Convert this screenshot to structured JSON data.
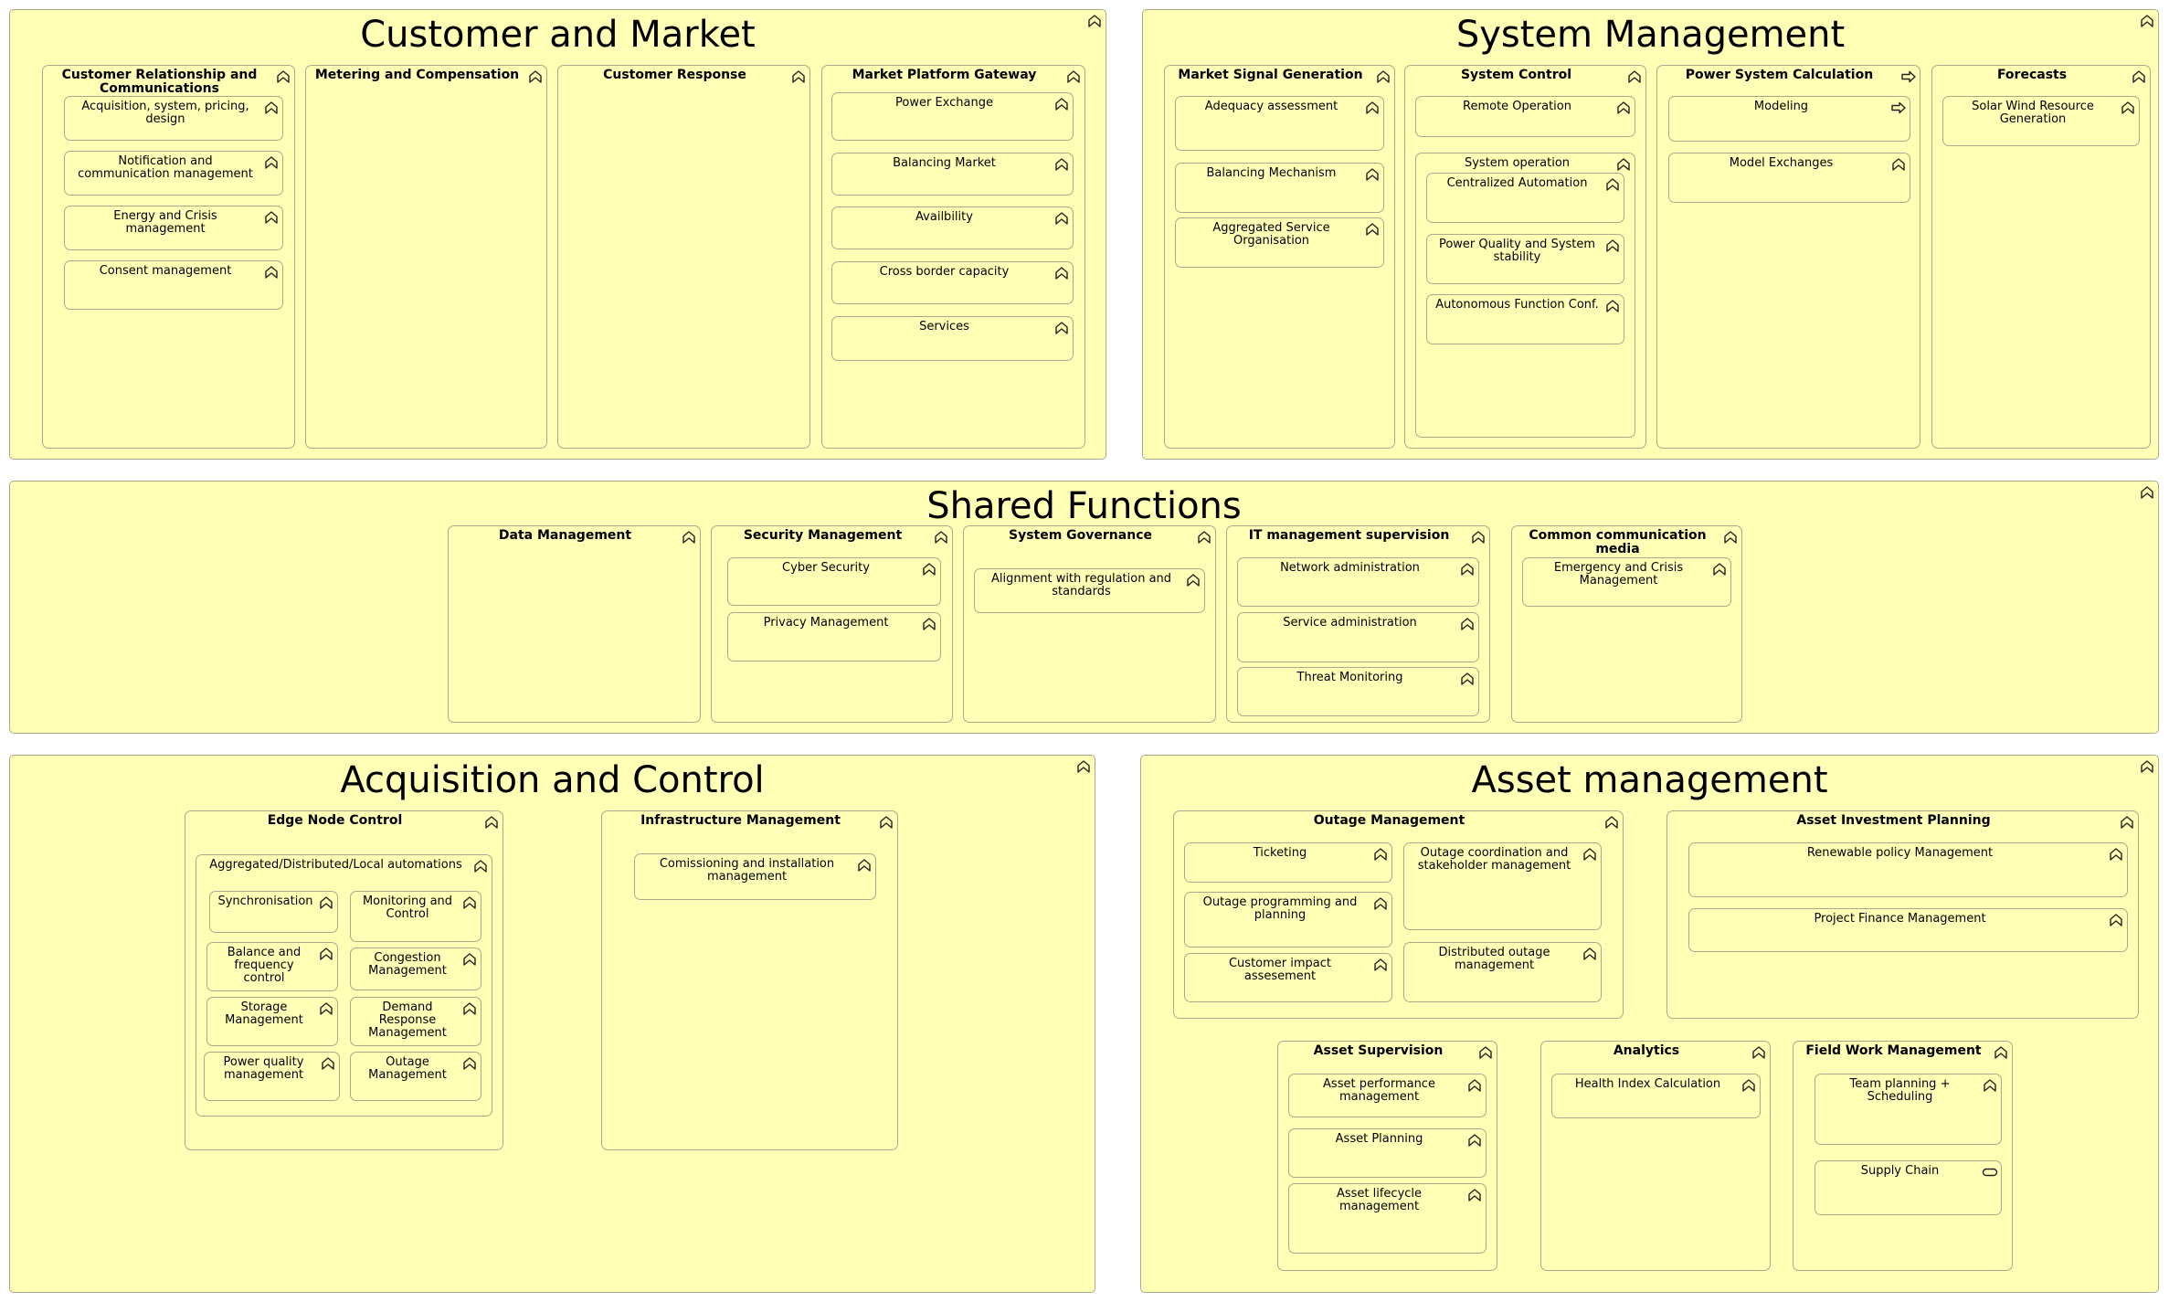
{
  "colors": {
    "fill": "#ffffb5",
    "border": "#a9a98a"
  },
  "customer_market": {
    "title": "Customer and Market",
    "crc": {
      "title": "Customer Relationship and Communications",
      "items": [
        "Acquisition, system, pricing, design",
        "Notification and communication management",
        "Energy and Crisis management",
        "Consent management"
      ]
    },
    "metering": {
      "title": "Metering and Compensation"
    },
    "response": {
      "title": "Customer Response"
    },
    "gateway": {
      "title": "Market Platform Gateway",
      "items": [
        "Power Exchange",
        "Balancing Market",
        "Availbility",
        "Cross border capacity",
        "Services"
      ]
    }
  },
  "system_management": {
    "title": "System Management",
    "signal": {
      "title": "Market Signal Generation",
      "items": [
        "Adequacy assessment",
        "Balancing Mechanism",
        "Aggregated Service Organisation"
      ]
    },
    "control": {
      "title": "System Control",
      "remote": "Remote Operation",
      "operation": {
        "title": "System operation",
        "items": [
          "Centralized Automation",
          "Power Quality and System stability",
          "Autonomous Function Conf."
        ]
      }
    },
    "calc": {
      "title": "Power System Calculation",
      "items": [
        "Modeling",
        "Model Exchanges"
      ]
    },
    "forecasts": {
      "title": "Forecasts",
      "items": [
        "Solar Wind Resource Generation"
      ]
    }
  },
  "shared": {
    "title": "Shared Functions",
    "data": {
      "title": "Data Management"
    },
    "security": {
      "title": "Security Management",
      "items": [
        "Cyber Security",
        "Privacy Management"
      ]
    },
    "governance": {
      "title": "System Governance",
      "items": [
        "Alignment with regulation and standards"
      ]
    },
    "it": {
      "title": "IT management supervision",
      "items": [
        "Network administration",
        "Service administration",
        "Threat Monitoring"
      ]
    },
    "comm": {
      "title": "Common communication media",
      "items": [
        "Emergency and Crisis Management"
      ]
    }
  },
  "acquisition_control": {
    "title": "Acquisition and Control",
    "edge": {
      "title": "Edge Node Control",
      "auto": {
        "title": "Aggregated/Distributed/Local automations",
        "items": [
          "Synchronisation",
          "Monitoring and Control",
          "Balance and frequency control",
          "Congestion Management",
          "Storage Management",
          "Demand Response Management",
          "Power quality management",
          "Outage Management"
        ]
      }
    },
    "infra": {
      "title": "Infrastructure Management",
      "items": [
        "Comissioning and installation management"
      ]
    }
  },
  "asset_management": {
    "title": "Asset management",
    "outage": {
      "title": "Outage Management",
      "items": [
        "Ticketing",
        "Outage coordination and stakeholder management",
        "Outage programming and planning",
        "Customer impact assesement",
        "Distributed outage management"
      ]
    },
    "investment": {
      "title": "Asset Investment Planning",
      "items": [
        "Renewable policy Management",
        "Project Finance Management"
      ]
    },
    "supervision": {
      "title": "Asset Supervision",
      "items": [
        "Asset performance management",
        "Asset Planning",
        "Asset lifecycle management"
      ]
    },
    "analytics": {
      "title": "Analytics",
      "items": [
        "Health Index Calculation"
      ]
    },
    "fieldwork": {
      "title": "Field Work Management",
      "items": [
        "Team planning + Scheduling",
        "Supply Chain"
      ]
    }
  }
}
